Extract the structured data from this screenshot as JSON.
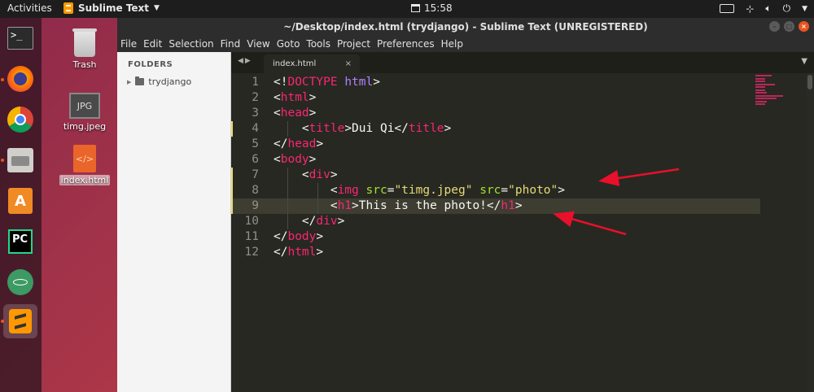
{
  "topbar": {
    "activities": "Activities",
    "app_name": "Sublime Text",
    "time": "15:58"
  },
  "desktop": {
    "icons": [
      {
        "label": "Trash"
      },
      {
        "label": "timg.jpeg"
      },
      {
        "label": "index.html"
      }
    ],
    "jpg_badge": "JPG",
    "html_badge": "</>"
  },
  "window": {
    "title": "~/Desktop/index.html (trydjango) - Sublime Text (UNREGISTERED)",
    "menu": [
      "File",
      "Edit",
      "Selection",
      "Find",
      "View",
      "Goto",
      "Tools",
      "Project",
      "Preferences",
      "Help"
    ],
    "sidebar": {
      "header": "FOLDERS",
      "folder": "trydjango"
    },
    "tab": {
      "label": "index.html",
      "close": "×"
    }
  },
  "editor": {
    "current_line": 9,
    "lines": [
      {
        "n": "1",
        "tokens": [
          [
            "p",
            "<!"
          ],
          [
            "tag",
            "DOCTYPE"
          ],
          [
            "p",
            " "
          ],
          [
            "kw",
            "html"
          ],
          [
            "p",
            ">"
          ]
        ]
      },
      {
        "n": "2",
        "tokens": [
          [
            "p",
            "<"
          ],
          [
            "tag",
            "html"
          ],
          [
            "p",
            ">"
          ]
        ]
      },
      {
        "n": "3",
        "tokens": [
          [
            "p",
            "<"
          ],
          [
            "tag",
            "head"
          ],
          [
            "p",
            ">"
          ]
        ]
      },
      {
        "n": "4",
        "tokens": [
          [
            "p",
            "    <"
          ],
          [
            "tag",
            "title"
          ],
          [
            "p",
            ">Dui Qi</"
          ],
          [
            "tag",
            "title"
          ],
          [
            "p",
            ">"
          ]
        ]
      },
      {
        "n": "5",
        "tokens": [
          [
            "p",
            "</"
          ],
          [
            "tag",
            "head"
          ],
          [
            "p",
            ">"
          ]
        ]
      },
      {
        "n": "6",
        "tokens": [
          [
            "p",
            "<"
          ],
          [
            "tag",
            "body"
          ],
          [
            "p",
            ">"
          ]
        ]
      },
      {
        "n": "7",
        "tokens": [
          [
            "p",
            "    <"
          ],
          [
            "tag",
            "div"
          ],
          [
            "p",
            ">"
          ]
        ]
      },
      {
        "n": "8",
        "tokens": [
          [
            "p",
            "        <"
          ],
          [
            "tag",
            "img"
          ],
          [
            "p",
            " "
          ],
          [
            "attr",
            "src"
          ],
          [
            "p",
            "="
          ],
          [
            "str",
            "\"timg.jpeg\""
          ],
          [
            "p",
            " "
          ],
          [
            "attr",
            "src"
          ],
          [
            "p",
            "="
          ],
          [
            "str",
            "\"photo\""
          ],
          [
            "p",
            ">"
          ]
        ]
      },
      {
        "n": "9",
        "tokens": [
          [
            "p",
            "        <"
          ],
          [
            "tag",
            "h1"
          ],
          [
            "p",
            ">This is the photo!</"
          ],
          [
            "tag",
            "h1"
          ],
          [
            "p",
            ">"
          ]
        ]
      },
      {
        "n": "10",
        "tokens": [
          [
            "p",
            "    </"
          ],
          [
            "tag",
            "div"
          ],
          [
            "p",
            ">"
          ]
        ]
      },
      {
        "n": "11",
        "tokens": [
          [
            "p",
            "</"
          ],
          [
            "tag",
            "body"
          ],
          [
            "p",
            ">"
          ]
        ]
      },
      {
        "n": "12",
        "tokens": [
          [
            "p",
            "</"
          ],
          [
            "tag",
            "html"
          ],
          [
            "p",
            ">"
          ]
        ]
      }
    ]
  },
  "colors": {
    "tag": "#f92672",
    "attr": "#a6e22e",
    "string": "#e6db74",
    "keyword": "#ae81ff",
    "annotation_arrow": "#e8102a"
  }
}
